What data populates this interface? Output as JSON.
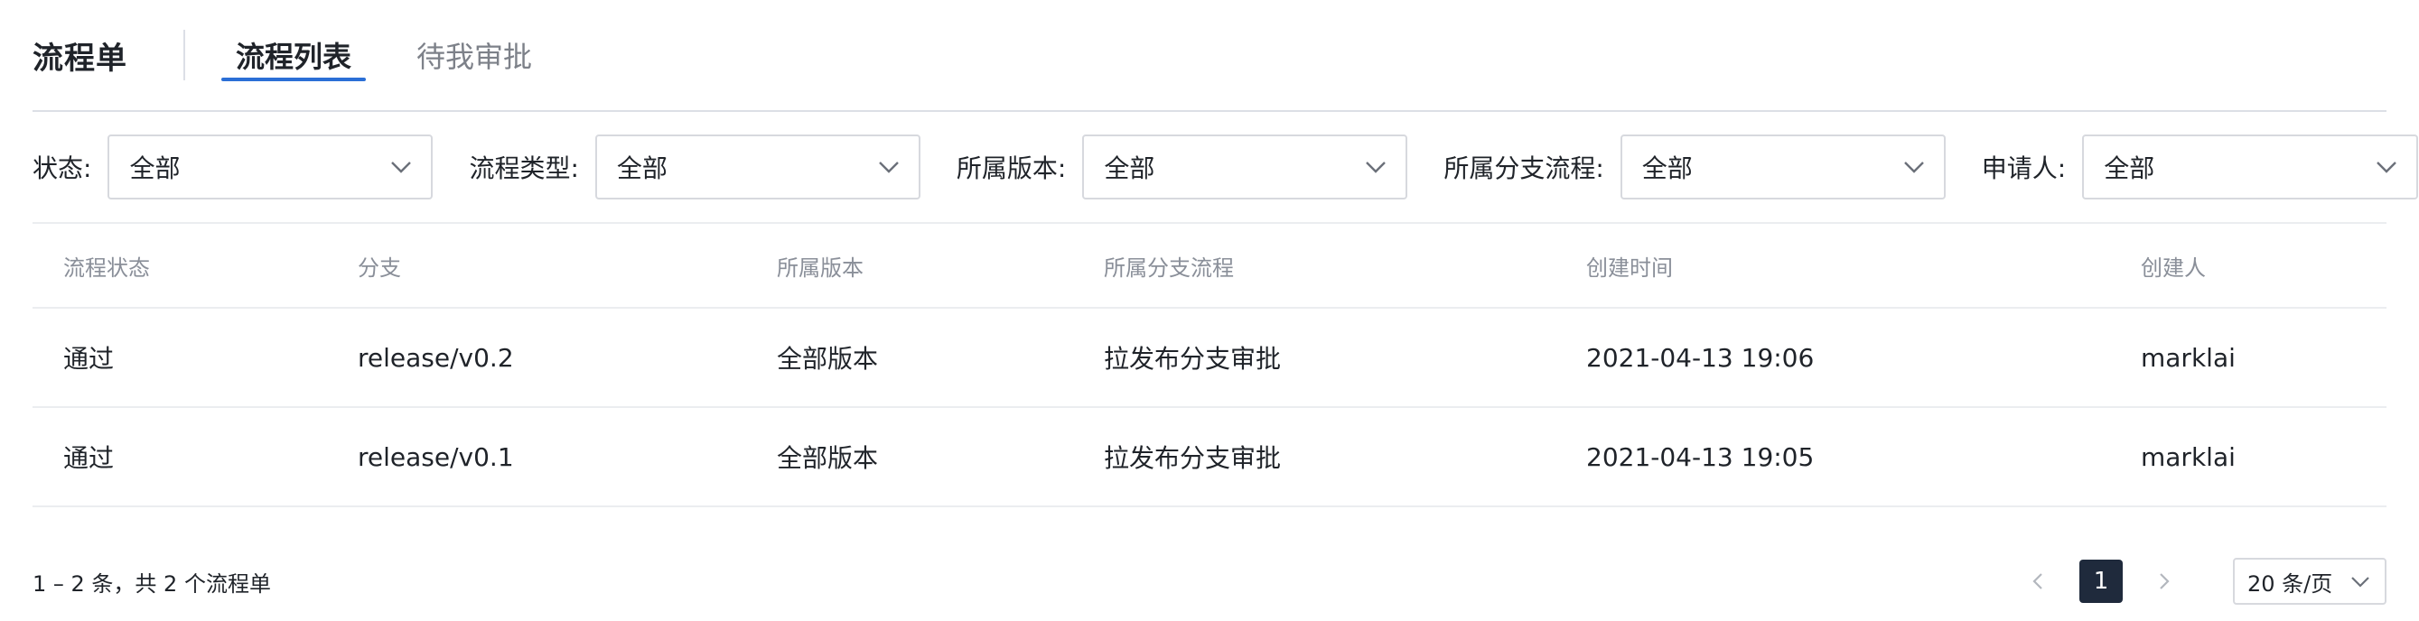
{
  "header": {
    "title": "流程单",
    "tabs": [
      {
        "label": "流程列表",
        "active": true
      },
      {
        "label": "待我审批",
        "active": false
      }
    ]
  },
  "filters": [
    {
      "label": "状态:",
      "value": "全部"
    },
    {
      "label": "流程类型:",
      "value": "全部"
    },
    {
      "label": "所属版本:",
      "value": "全部"
    },
    {
      "label": "所属分支流程:",
      "value": "全部"
    },
    {
      "label": "申请人:",
      "value": "全部"
    }
  ],
  "table": {
    "columns": [
      "流程状态",
      "分支",
      "所属版本",
      "所属分支流程",
      "创建时间",
      "创建人"
    ],
    "rows": [
      [
        "通过",
        "release/v0.2",
        "全部版本",
        "拉发布分支审批",
        "2021-04-13 19:06",
        "marklai"
      ],
      [
        "通过",
        "release/v0.1",
        "全部版本",
        "拉发布分支审批",
        "2021-04-13 19:05",
        "marklai"
      ]
    ]
  },
  "footer": {
    "summary": "1 – 2 条，共 2 个流程单",
    "current_page": "1",
    "page_size": "20 条/页"
  },
  "icons": {
    "select_arrow": "chevron-down-icon",
    "prev": "chevron-left-icon",
    "next": "chevron-right-icon"
  },
  "colors": {
    "accent": "#2b6fd6",
    "active_page_bg": "#1f2a3c"
  }
}
